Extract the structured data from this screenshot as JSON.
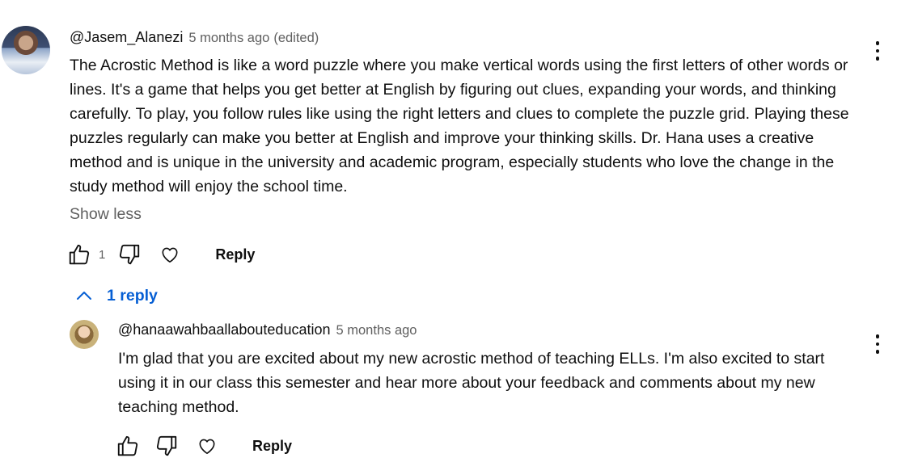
{
  "comment": {
    "author": "@Jasem_Alanezi",
    "time": "5 months ago",
    "edited": "(edited)",
    "text": "The Acrostic Method is like a word puzzle where you make vertical words using the first letters of other words or lines. It's a game that helps you get better at English by figuring out clues, expanding your words, and thinking carefully. To play, you follow rules like using the right letters and clues to complete the puzzle grid. Playing these puzzles regularly can make you better at English and improve your thinking skills. Dr. Hana uses a creative method and is unique in the university and academic program, especially students who love the change in the study method will enjoy the school time.",
    "show_less_label": "Show less",
    "like_count": "1",
    "reply_label": "Reply"
  },
  "replies_toggle": {
    "label": "1 reply"
  },
  "reply": {
    "author": "@hanaawahbaallabouteducation",
    "time": "5 months ago",
    "text": "I'm glad that you are excited about my new acrostic method of teaching ELLs. I'm also excited to start using it in our class this semester and hear more about your feedback and comments about my new teaching method.",
    "reply_label": "Reply"
  },
  "icons": {
    "like": "thumbs-up-icon",
    "dislike": "thumbs-down-icon",
    "heart": "heart-icon",
    "more": "more-vertical-icon",
    "chevron": "chevron-up-icon"
  },
  "colors": {
    "link_blue": "#065fd4",
    "secondary_text": "#606060",
    "primary_text": "#0f0f0f"
  }
}
